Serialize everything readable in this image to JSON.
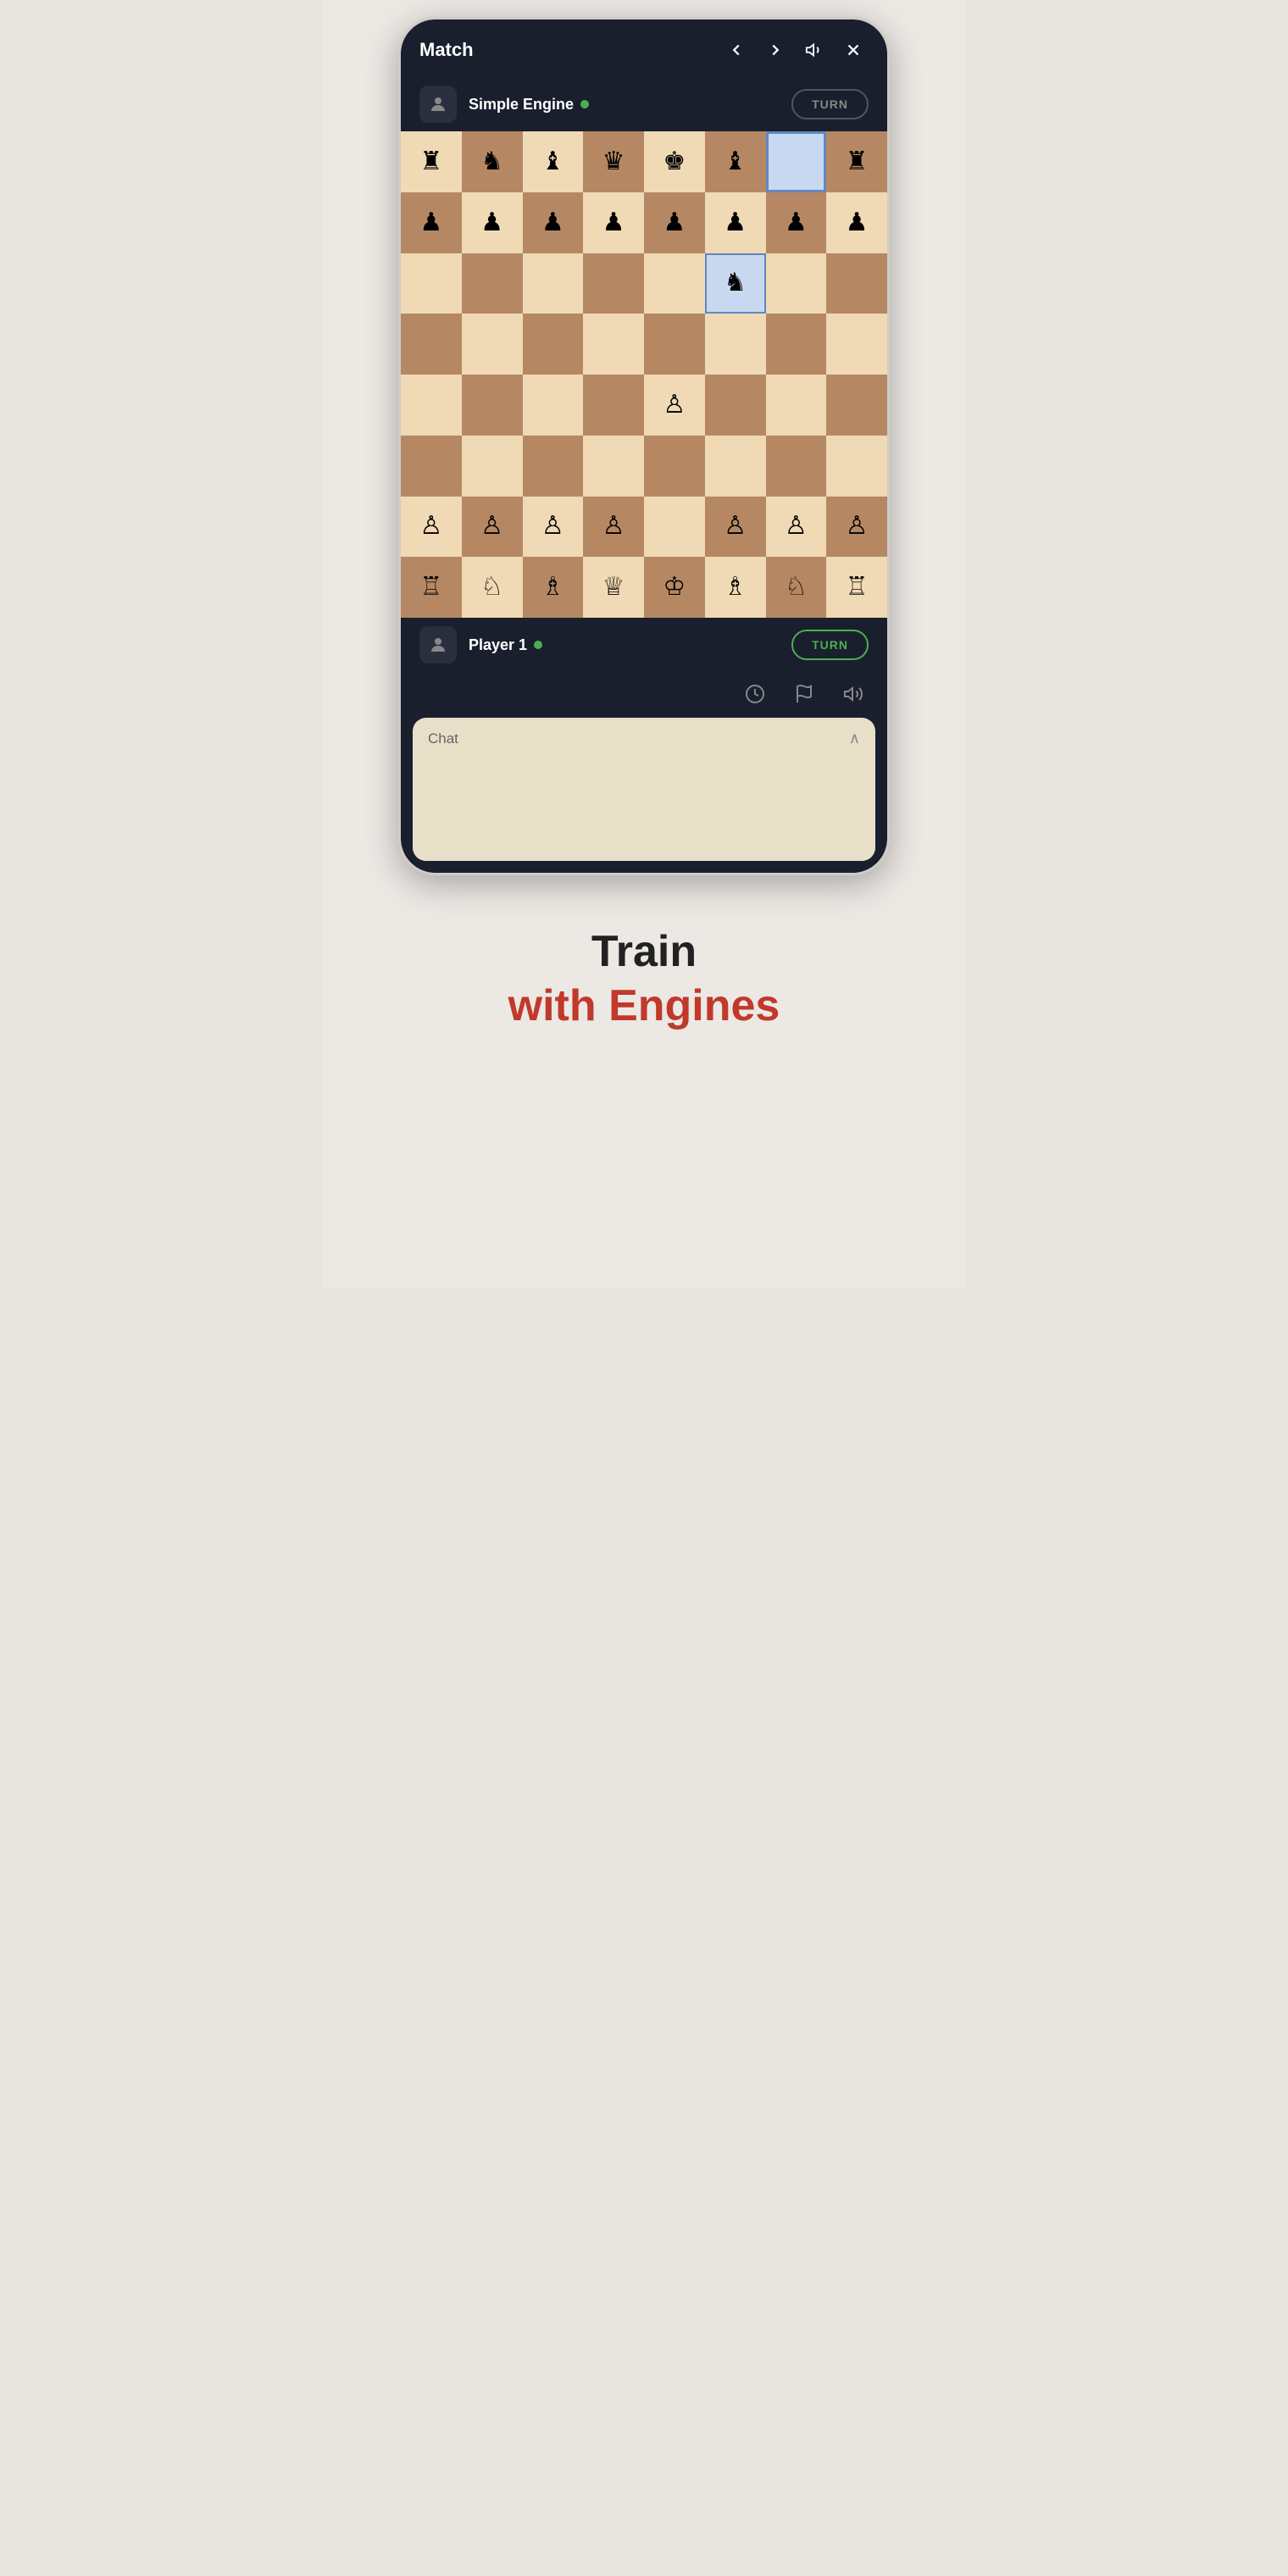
{
  "header": {
    "title": "Match",
    "back_label": "‹",
    "forward_label": "›",
    "sound_icon": "sound",
    "close_icon": "×"
  },
  "engine_player": {
    "name": "Simple Engine",
    "online": true,
    "turn_label": "TURN",
    "turn_active": false
  },
  "human_player": {
    "name": "Player 1",
    "online": true,
    "turn_label": "TURN",
    "turn_active": true
  },
  "board": {
    "rows": 8,
    "cols": 8,
    "pieces": [
      [
        "♜",
        "♞",
        "♝",
        "♛",
        "♚",
        "♝",
        "",
        "♜"
      ],
      [
        "♟",
        "♟",
        "♟",
        "♟",
        "♟",
        "♟",
        "♟",
        "♟"
      ],
      [
        "",
        "",
        "",
        "",
        "",
        "♞",
        "",
        ""
      ],
      [
        "",
        "",
        "",
        "",
        "",
        "",
        "",
        ""
      ],
      [
        "",
        "",
        "",
        "",
        "♙",
        "",
        "",
        ""
      ],
      [
        "",
        "",
        "",
        "",
        "",
        "",
        "",
        ""
      ],
      [
        "♙",
        "♙",
        "♙",
        "♙",
        "",
        "♙",
        "♙",
        "♙"
      ],
      [
        "♖",
        "♘",
        "♗",
        "♕",
        "♔",
        "♗",
        "♘",
        "♖"
      ]
    ],
    "highlighted_cell": [
      0,
      6
    ],
    "selected_cell": [
      2,
      5
    ]
  },
  "actions": {
    "history_icon": "⏱",
    "flag_icon": "⚑",
    "volume_icon": "🔊"
  },
  "chat": {
    "label": "Chat",
    "chevron": "∧",
    "placeholder": ""
  },
  "bottom": {
    "train_label": "Train",
    "engines_label": "with Engines"
  }
}
